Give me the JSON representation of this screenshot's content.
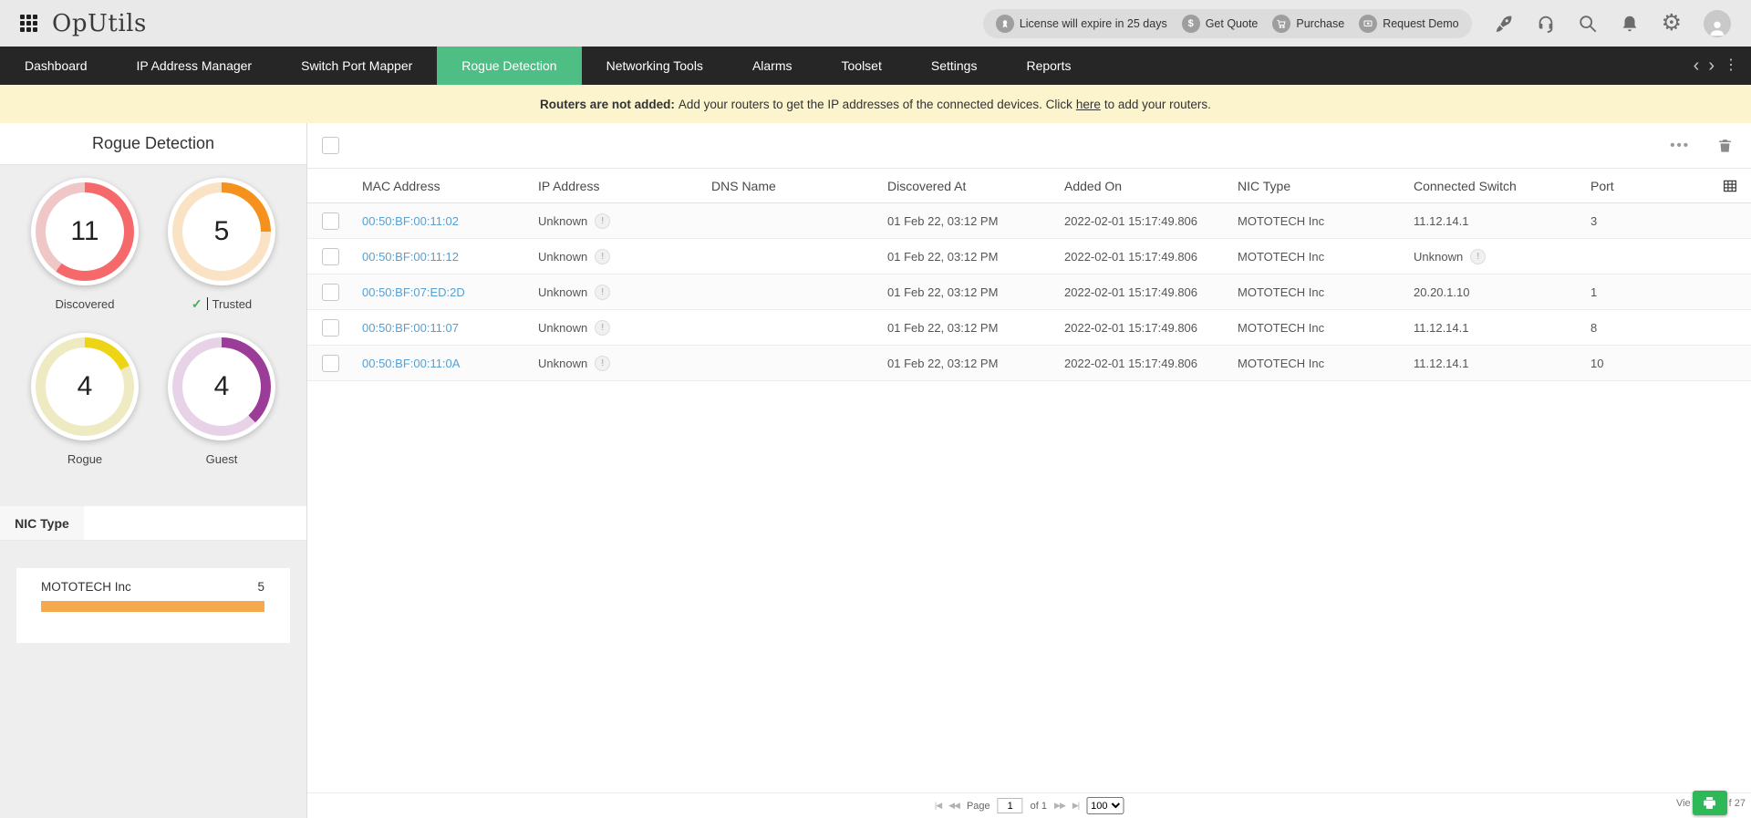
{
  "header": {
    "logo": "OpUtils",
    "license_pill": {
      "license": "License will expire in 25 days",
      "get_quote": "Get Quote",
      "purchase": "Purchase",
      "request_demo": "Request Demo"
    }
  },
  "nav": {
    "tabs": [
      "Dashboard",
      "IP Address Manager",
      "Switch Port Mapper",
      "Rogue Detection",
      "Networking Tools",
      "Alarms",
      "Toolset",
      "Settings",
      "Reports"
    ],
    "active": "Rogue Detection",
    "active_color": "#4ebe85"
  },
  "banner": {
    "bold": "Routers are not added:",
    "middle": "Add your routers to get the IP addresses of the connected devices. Click",
    "link": "here",
    "end": "to add your routers."
  },
  "sidebar": {
    "title": "Rogue Detection",
    "charts": [
      {
        "value": "11",
        "label": "Discovered",
        "dark": "#f5696b",
        "light": "#efc7c7",
        "fraction": 0.6,
        "check": false
      },
      {
        "value": "5",
        "label": "Trusted",
        "dark": "#f5921e",
        "light": "#fae3c5",
        "fraction": 0.25,
        "check": true
      },
      {
        "value": "4",
        "label": "Rogue",
        "dark": "#edd515",
        "light": "#eeeac2",
        "fraction": 0.18,
        "check": false
      },
      {
        "value": "4",
        "label": "Guest",
        "dark": "#9b3d98",
        "light": "#e7d2e8",
        "fraction": 0.38,
        "check": false
      }
    ],
    "nic_type": {
      "tab": "NIC Type",
      "vendor": "MOTOTECH Inc",
      "value": "5",
      "bar_color": "#f5a94e",
      "bar_fraction": 1.0
    }
  },
  "table": {
    "columns": [
      "MAC Address",
      "IP Address",
      "DNS Name",
      "Discovered At",
      "Added On",
      "NIC Type",
      "Connected Switch",
      "Port"
    ],
    "rows": [
      {
        "mac": "00:50:BF:00:11:02",
        "ip": "Unknown",
        "ip_info": true,
        "dns": "",
        "discovered": "01 Feb 22, 03:12 PM",
        "added": "2022-02-01 15:17:49.806",
        "nic": "MOTOTECH Inc",
        "switch": "11.12.14.1",
        "switch_info": false,
        "port": "3"
      },
      {
        "mac": "00:50:BF:00:11:12",
        "ip": "Unknown",
        "ip_info": true,
        "dns": "",
        "discovered": "01 Feb 22, 03:12 PM",
        "added": "2022-02-01 15:17:49.806",
        "nic": "MOTOTECH Inc",
        "switch": "Unknown",
        "switch_info": true,
        "port": ""
      },
      {
        "mac": "00:50:BF:07:ED:2D",
        "ip": "Unknown",
        "ip_info": true,
        "dns": "",
        "discovered": "01 Feb 22, 03:12 PM",
        "added": "2022-02-01 15:17:49.806",
        "nic": "MOTOTECH Inc",
        "switch": "20.20.1.10",
        "switch_info": false,
        "port": "1"
      },
      {
        "mac": "00:50:BF:00:11:07",
        "ip": "Unknown",
        "ip_info": true,
        "dns": "",
        "discovered": "01 Feb 22, 03:12 PM",
        "added": "2022-02-01 15:17:49.806",
        "nic": "MOTOTECH Inc",
        "switch": "11.12.14.1",
        "switch_info": false,
        "port": "8"
      },
      {
        "mac": "00:50:BF:00:11:0A",
        "ip": "Unknown",
        "ip_info": true,
        "dns": "",
        "discovered": "01 Feb 22, 03:12 PM",
        "added": "2022-02-01 15:17:49.806",
        "nic": "MOTOTECH Inc",
        "switch": "11.12.14.1",
        "switch_info": false,
        "port": "10"
      }
    ]
  },
  "footer": {
    "page_label": "Page",
    "page_value": "1",
    "of_label": "of 1",
    "page_size": "100",
    "right_before": "Vie",
    "right_after": "f 27"
  }
}
